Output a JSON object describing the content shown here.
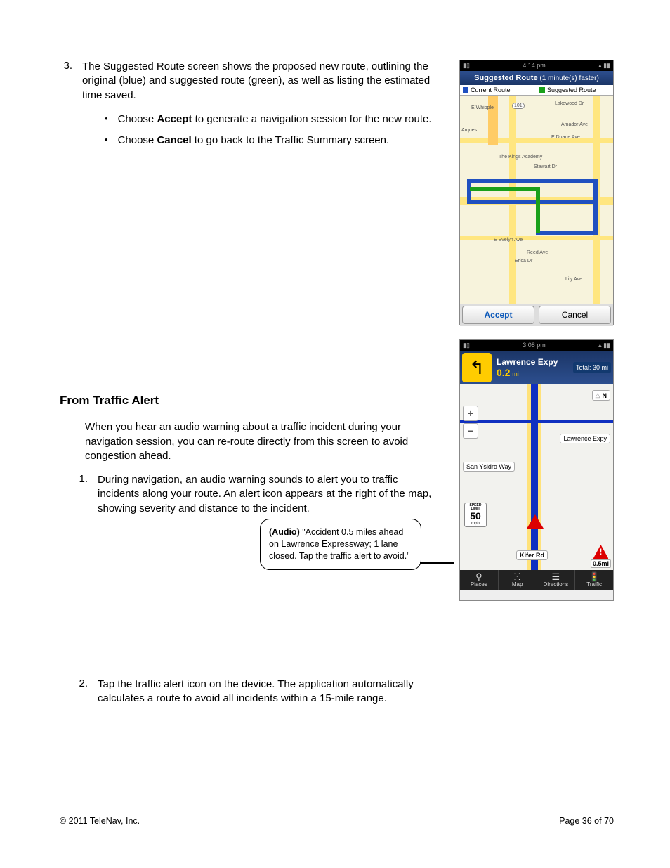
{
  "list3": {
    "num": "3.",
    "text": "The Suggested Route screen shows the proposed new route, outlining the original (blue) and suggested route (green), as well as listing the estimated time saved.",
    "bullets": [
      {
        "pre": "Choose ",
        "bold": "Accept",
        "post": " to generate a navigation session for the new route."
      },
      {
        "pre": "Choose ",
        "bold": "Cancel",
        "post": " to go back to the Traffic Summary screen."
      }
    ]
  },
  "section_heading": "From Traffic Alert",
  "intro_para": "When you hear an audio warning about a traffic incident during your navigation session, you can re-route directly from this screen to avoid congestion ahead.",
  "list1": {
    "num": "1.",
    "text": "During navigation, an audio warning sounds to alert you to traffic incidents along your route. An alert icon appears at the right of the map, showing severity and distance to the incident."
  },
  "callout": {
    "bold": "(Audio)",
    "text": " \"Accident 0.5 miles ahead on Lawrence Expressway; 1 lane closed. Tap the traffic alert to avoid.\""
  },
  "list2": {
    "num": "2.",
    "text": "Tap the traffic alert icon on the device. The application automatically calculates a route to avoid all incidents within a 15-mile range."
  },
  "footer": {
    "copyright": "© 2011 TeleNav, Inc.",
    "page": "Page 36 of 70"
  },
  "phone1": {
    "time": "4:14 pm",
    "header_bold": "Suggested Route",
    "header_note": "(1 minute(s) faster)",
    "legend_current": "Current Route",
    "legend_suggested": "Suggested Route",
    "accept": "Accept",
    "cancel": "Cancel",
    "labels": {
      "hwy": "101",
      "ewhipple": "E Whipple",
      "amador": "Amador Ave",
      "eduane": "E Duane Ave",
      "kings": "The Kings Academy",
      "stewart": "Stewart Dr",
      "evelyn": "E Evelyn Ave",
      "reed": "Reed Ave",
      "erica": "Erica Dr",
      "lily": "Lily Ave",
      "lakewood": "Lakewood Dr",
      "arques": "Arques"
    }
  },
  "phone2": {
    "time": "3:08 pm",
    "street": "Lawrence Expy",
    "dist": "0.2",
    "dist_unit": "mi",
    "total": "Total: 30 mi",
    "north": "N",
    "label_lawrence": "Lawrence Expy",
    "label_sanysidro": "San Ysidro Way",
    "label_kifer": "Kifer Rd",
    "speed_top": "SPEED LIMIT",
    "speed_val": "50",
    "speed_unit": "mph",
    "alert_dist": "0.5mi",
    "tabs": {
      "places": "Places",
      "map": "Map",
      "directions": "Directions",
      "traffic": "Traffic"
    }
  }
}
